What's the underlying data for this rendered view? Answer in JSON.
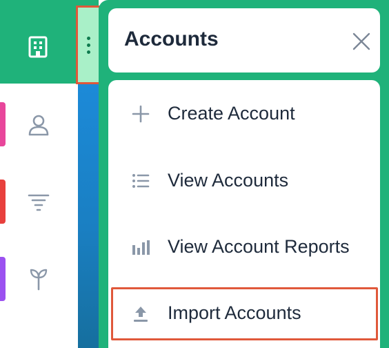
{
  "menu": {
    "title": "Accounts",
    "close_icon": "close-icon",
    "items": [
      {
        "label": "Create Account",
        "icon": "plus-icon"
      },
      {
        "label": "View Accounts",
        "icon": "list-icon"
      },
      {
        "label": "View Account Reports",
        "icon": "bar-chart-icon"
      },
      {
        "label": "Import Accounts",
        "icon": "upload-icon"
      }
    ]
  },
  "rail": {
    "active_module_icon": "building-icon",
    "modules": [
      {
        "icon": "contact-icon",
        "tab_color": "#e8469b"
      },
      {
        "icon": "funnel-icon",
        "tab_color": "#e8403d"
      },
      {
        "icon": "sprout-icon",
        "tab_color": "#9b51f0"
      }
    ]
  },
  "colors": {
    "accent_green": "#1fb27a",
    "highlight": "#e0583a",
    "text": "#1e2a3b",
    "strip_blue": "#1a7fc2"
  }
}
